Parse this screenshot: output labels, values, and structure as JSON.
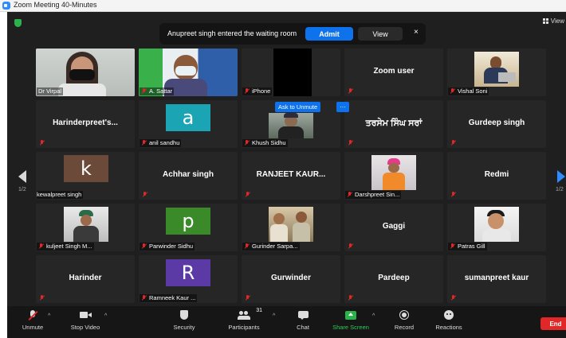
{
  "window": {
    "title": "Zoom Meeting 40-Minutes"
  },
  "topbar": {
    "view_label": "View"
  },
  "waiting_room": {
    "message": "Anupreet singh entered the waiting room",
    "admit_label": "Admit",
    "view_label": "View",
    "close_glyph": "×"
  },
  "tiles": {
    "r1": [
      "Dr Virpal",
      "A. Sattar",
      "iPhone",
      "Zoom user",
      "Vishal Soni"
    ],
    "r2": [
      "Harinderpreet's...",
      "anil sandhu",
      "Khush Sidhu",
      "ਤਰਸੇਮ ਸਿੰਘ ਸਰਾਂ",
      "Gurdeep singh"
    ],
    "r3": [
      "kewalpreet singh",
      "Achhar singh",
      "RANJEET KAUR...",
      "Darshpreet Sin...",
      "Redmi"
    ],
    "r4": [
      "kuljeet Singh M...",
      "Parwinder Sidhu",
      "Gurinder Sarpa...",
      "Gaggi",
      "Patras Gill"
    ],
    "r5": [
      "Harinder",
      "Ramneek Kaur ...",
      "Gurwinder",
      "Pardeep",
      "sumanpreet kaur"
    ]
  },
  "avatars": {
    "anil": "a",
    "kewal": "k",
    "parwinder": "p",
    "ramneek": "R"
  },
  "colors": {
    "avatar_teal": "#1aa4b4",
    "avatar_brown": "#6b4a3a",
    "avatar_green": "#3b8a2a",
    "avatar_purple": "#5b3aa6",
    "accent": "#0e72ed",
    "end": "#e02828"
  },
  "overlay": {
    "ask_unmute": "Ask to Unmute",
    "more": "···"
  },
  "pagination": {
    "left": "1/2",
    "right": "1/2"
  },
  "toolbar": {
    "unmute": "Unmute",
    "stop_video": "Stop Video",
    "security": "Security",
    "participants": "Participants",
    "participants_count": "31",
    "chat": "Chat",
    "share_screen": "Share Screen",
    "record": "Record",
    "reactions": "Reactions",
    "end": "End"
  }
}
